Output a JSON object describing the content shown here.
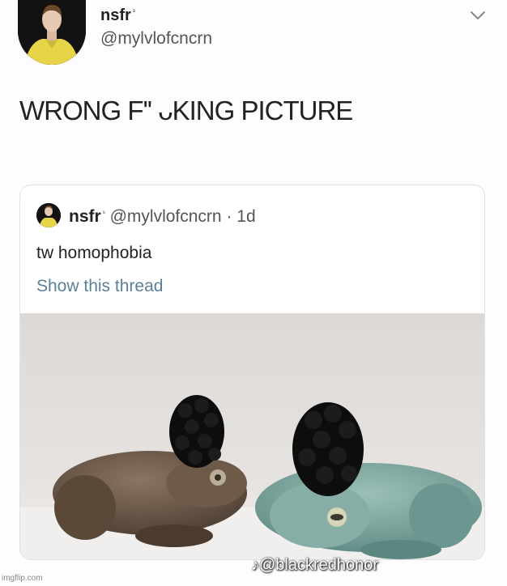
{
  "tweet": {
    "author_name": "nsfr",
    "author_sup": "ˢ",
    "author_handle": "@mylvlofcncrn",
    "text": "WRONG F'' ᴗKING PICTURE"
  },
  "quoted_tweet": {
    "author_name": "nsfr",
    "author_sup": "ˢ",
    "author_handle": "@mylvlofcncrn",
    "separator": "·",
    "time": "1d",
    "text": "tw homophobia",
    "show_thread": "Show this thread"
  },
  "overlay": {
    "tiktok_handle": "@blackredhonor"
  },
  "watermark": "imgflip.com",
  "icons": {
    "more": "chevron-down-icon",
    "tiktok": "tiktok-icon"
  },
  "colors": {
    "link": "#5b7f96",
    "text": "#222222",
    "muted": "#555555",
    "avatar_shirt": "#e7d54a"
  }
}
